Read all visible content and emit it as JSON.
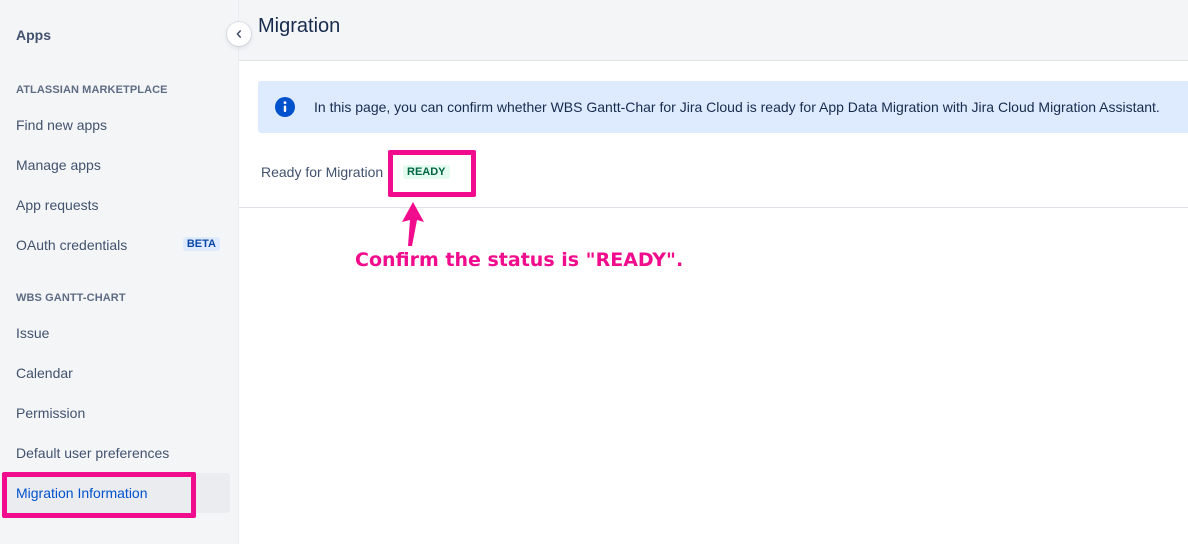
{
  "sidebar": {
    "title": "Apps",
    "sections": [
      {
        "header": "ATLASSIAN MARKETPLACE",
        "items": [
          {
            "label": "Find new apps"
          },
          {
            "label": "Manage apps"
          },
          {
            "label": "App requests"
          },
          {
            "label": "OAuth credentials",
            "badge": "BETA"
          }
        ]
      },
      {
        "header": "WBS GANTT-CHART",
        "items": [
          {
            "label": "Issue"
          },
          {
            "label": "Calendar"
          },
          {
            "label": "Permission"
          },
          {
            "label": "Default user preferences"
          },
          {
            "label": "Migration Information",
            "active": true
          }
        ]
      }
    ],
    "collapse_icon": "chevron-left-icon"
  },
  "main": {
    "title": "Migration",
    "info": {
      "icon": "info-icon",
      "text": "In this page, you can confirm whether WBS Gantt-Char for Jira Cloud is ready for App Data Migration with Jira Cloud Migration Assistant."
    },
    "status": {
      "label": "Ready for Migration",
      "value": "READY"
    }
  },
  "annotation": {
    "callout": "Confirm the status is \"READY\".",
    "color": "#f00c8c"
  },
  "colors": {
    "accent": "#0052cc",
    "info_bg": "#deebff",
    "ready_text": "#006644",
    "ready_bg": "#e3fcef"
  }
}
